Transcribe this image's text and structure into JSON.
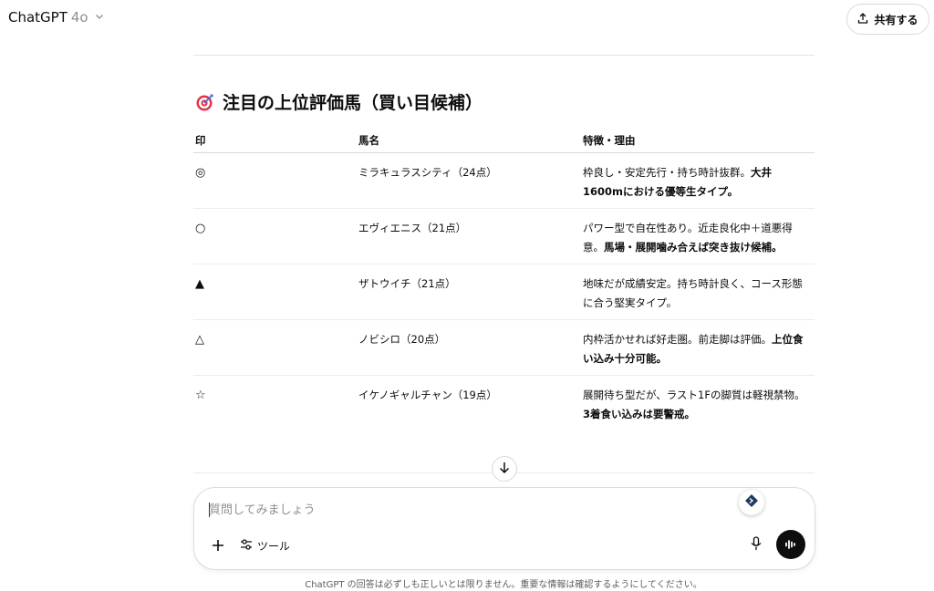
{
  "header": {
    "brand": "ChatGPT",
    "model_version": "4o",
    "share_label": "共有する"
  },
  "content": {
    "heading_emoji": "target-icon",
    "heading": "注目の上位評価馬（買い目候補）",
    "table": {
      "headers": [
        "印",
        "馬名",
        "特徴・理由"
      ],
      "rows": [
        {
          "mark": "◎",
          "name": "ミラキュラスシティ（24点）",
          "reason_plain": "枠良し・安定先行・持ち時計抜群。",
          "reason_bold": "大井1600mにおける優等生タイプ。"
        },
        {
          "mark": "○",
          "name": "エヴィエニス（21点）",
          "reason_plain": "パワー型で自在性あり。近走良化中＋道悪得意。",
          "reason_bold": "馬場・展開噛み合えば突き抜け候補。"
        },
        {
          "mark": "▲",
          "name": "ザトウイチ（21点）",
          "reason_plain": "地味だが成績安定。持ち時計良く、コース形態に合う堅実タイプ。",
          "reason_bold": ""
        },
        {
          "mark": "△",
          "name": "ノビシロ（20点）",
          "reason_plain": "内枠活かせれば好走圏。前走脚は評価。",
          "reason_bold": "上位食い込み十分可能。"
        },
        {
          "mark": "☆",
          "name": "イケノギャルチャン（19点）",
          "reason_plain": "展開待ち型だが、ラスト1Fの脚質は軽視禁物。",
          "reason_bold": "3着食い込みは要警戒。"
        }
      ]
    }
  },
  "composer": {
    "placeholder": "質問してみましょう",
    "tools_label": "ツール"
  },
  "footer": {
    "disclaimer": "ChatGPT の回答は必ずしも正しいとは限りません。重要な情報は確認するようにしてください。"
  },
  "colors": {
    "accent_dark": "#0d0d0d",
    "border": "#d9d9d9",
    "muted_text": "#8f8f8f",
    "target_red": "#e2334a"
  }
}
